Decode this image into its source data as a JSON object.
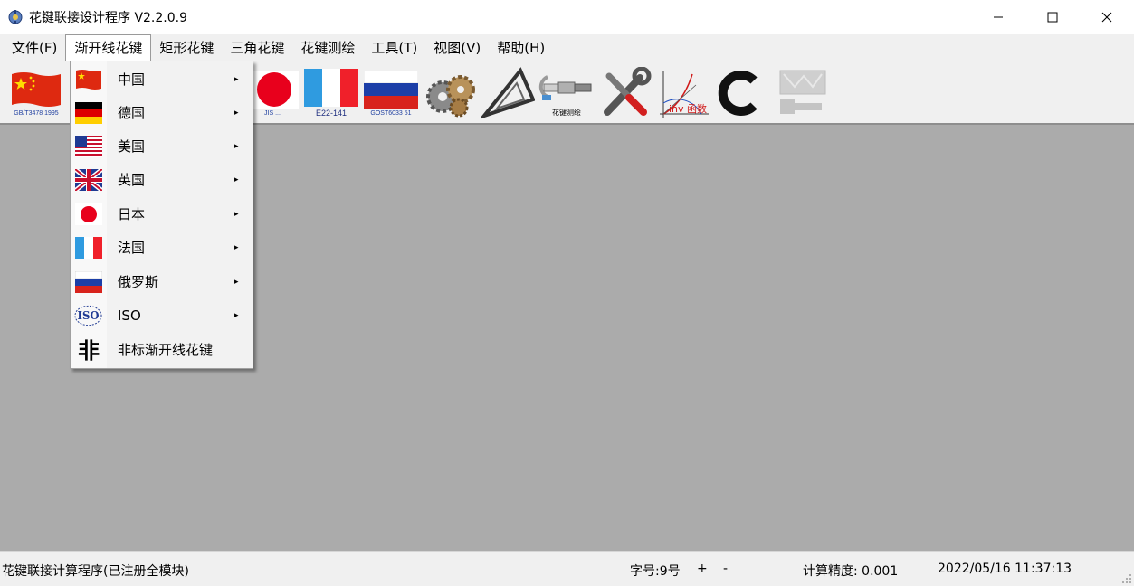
{
  "window": {
    "title": "花键联接设计程序 V2.2.0.9",
    "minimize_icon": "minimize-icon",
    "maximize_icon": "maximize-icon",
    "close_icon": "close-icon"
  },
  "menubar": {
    "items": [
      {
        "label": "文件(F)"
      },
      {
        "label": "渐开线花键",
        "active": true
      },
      {
        "label": "矩形花键"
      },
      {
        "label": "三角花键"
      },
      {
        "label": "花键测绘"
      },
      {
        "label": "工具(T)"
      },
      {
        "label": "视图(V)"
      },
      {
        "label": "帮助(H)"
      }
    ]
  },
  "toolbar": {
    "buttons": [
      {
        "icon": "china-flag-icon",
        "caption": "GB/T3478 1995"
      },
      {
        "icon": "japan-flag-icon",
        "caption": "JIS ..."
      },
      {
        "icon": "france-flag-icon",
        "caption": "E22-141"
      },
      {
        "icon": "russia-flag-icon",
        "caption": "GOST6033 51"
      },
      {
        "icon": "gears-icon",
        "caption": ""
      },
      {
        "icon": "triangle-icon",
        "caption": ""
      },
      {
        "icon": "micrometer-icon",
        "caption": "花键测绘"
      },
      {
        "icon": "tools-icon",
        "caption": ""
      },
      {
        "icon": "involute-function-icon",
        "caption": "inv 函数"
      },
      {
        "icon": "snap-ring-icon",
        "caption": ""
      },
      {
        "icon": "disabled-part-icon",
        "caption": ""
      }
    ]
  },
  "dropdown": {
    "items": [
      {
        "label": "中国",
        "icon": "china-flag-icon",
        "submenu": true
      },
      {
        "label": "德国",
        "icon": "germany-flag-icon",
        "submenu": true
      },
      {
        "label": "美国",
        "icon": "usa-flag-icon",
        "submenu": true
      },
      {
        "label": "英国",
        "icon": "uk-flag-icon",
        "submenu": true
      },
      {
        "label": "日本",
        "icon": "japan-flag-icon",
        "submenu": true
      },
      {
        "label": "法国",
        "icon": "france-flag-icon",
        "submenu": true
      },
      {
        "label": "俄罗斯",
        "icon": "russia-flag-icon",
        "submenu": true
      },
      {
        "label": "ISO",
        "icon": "iso-logo-icon",
        "icon_text": "ISO",
        "submenu": true
      },
      {
        "label": "非标渐开线花键",
        "icon": "nonstandard-glyph-icon",
        "icon_text": "非",
        "submenu": false
      }
    ],
    "submenu_arrow": "▸"
  },
  "statusbar": {
    "program": "花键联接计算程序(已注册全模块)",
    "font_size": "字号:9号",
    "plus": "+",
    "minus": "-",
    "precision": "计算精度: 0.001",
    "datetime": "2022/05/16 11:37:13"
  },
  "colors": {
    "workspace": "#ababab",
    "chrome": "#f0f0f0",
    "flag_red": "#de2910",
    "flag_yellow": "#ffde00"
  }
}
